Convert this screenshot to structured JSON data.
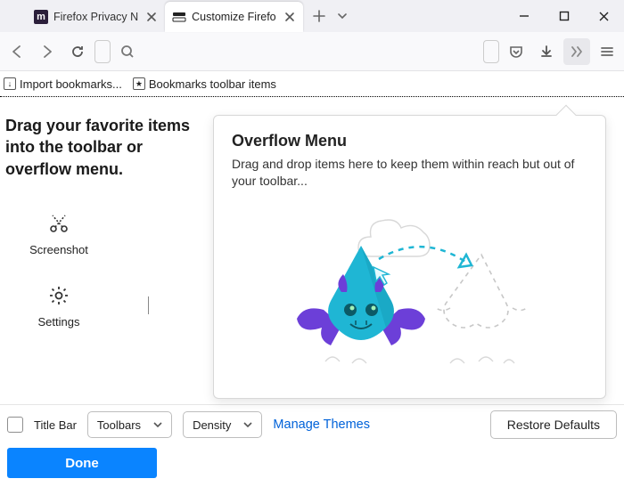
{
  "tabs": {
    "inactive": {
      "label": "Firefox Privacy N"
    },
    "active": {
      "label": "Customize Firefo"
    }
  },
  "bookmarks_bar": {
    "import_label": "Import bookmarks...",
    "items_label": "Bookmarks toolbar items"
  },
  "customize": {
    "instruction": "Drag your favorite items into the toolbar or overflow menu.",
    "items": [
      {
        "label": "Screenshot"
      },
      {
        "label": "Settings"
      }
    ]
  },
  "overflow": {
    "title": "Overflow Menu",
    "description": "Drag and drop items here to keep them within reach but out of your toolbar..."
  },
  "bottom": {
    "title_bar_label": "Title Bar",
    "toolbars_label": "Toolbars",
    "density_label": "Density",
    "manage_themes": "Manage Themes",
    "restore_defaults": "Restore Defaults",
    "done": "Done"
  }
}
